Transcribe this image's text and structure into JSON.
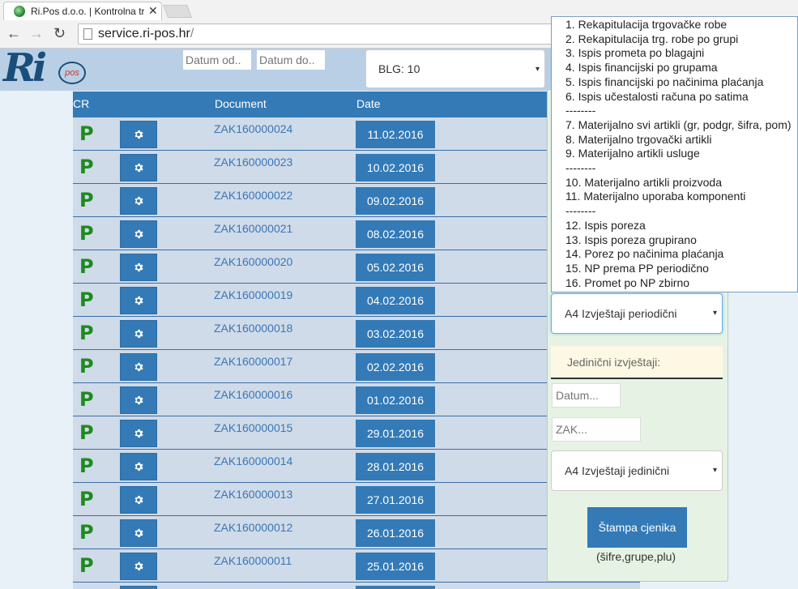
{
  "browser": {
    "tab_title": "Ri.Pos d.o.o. | Kontrolna tra",
    "tab_close": "✕",
    "nav_back": "←",
    "nav_forward": "→",
    "nav_reload": "↻",
    "url_host": "service.ri-pos.hr",
    "url_path": "/"
  },
  "header": {
    "logo_main": "Ri",
    "logo_badge": "pos",
    "date_from_placeholder": "Datum od..",
    "date_to_placeholder": "Datum do..",
    "blg_value": "BLG: 10",
    "caret": "▾"
  },
  "table": {
    "col_cr": "CR",
    "col_document": "Document",
    "col_date": "Date",
    "rows": [
      {
        "status": "P",
        "document": "ZAK160000024",
        "date": "11.02.2016"
      },
      {
        "status": "P",
        "document": "ZAK160000023",
        "date": "10.02.2016"
      },
      {
        "status": "P",
        "document": "ZAK160000022",
        "date": "09.02.2016"
      },
      {
        "status": "P",
        "document": "ZAK160000021",
        "date": "08.02.2016"
      },
      {
        "status": "P",
        "document": "ZAK160000020",
        "date": "05.02.2016"
      },
      {
        "status": "P",
        "document": "ZAK160000019",
        "date": "04.02.2016"
      },
      {
        "status": "P",
        "document": "ZAK160000018",
        "date": "03.02.2016"
      },
      {
        "status": "P",
        "document": "ZAK160000017",
        "date": "02.02.2016"
      },
      {
        "status": "P",
        "document": "ZAK160000016",
        "date": "01.02.2016"
      },
      {
        "status": "P",
        "document": "ZAK160000015",
        "date": "29.01.2016"
      },
      {
        "status": "P",
        "document": "ZAK160000014",
        "date": "28.01.2016"
      },
      {
        "status": "P",
        "document": "ZAK160000013",
        "date": "27.01.2016"
      },
      {
        "status": "P",
        "document": "ZAK160000012",
        "date": "26.01.2016"
      },
      {
        "status": "P",
        "document": "ZAK160000011",
        "date": "25.01.2016"
      },
      {
        "status": "",
        "document": "",
        "date": ""
      }
    ]
  },
  "reports": {
    "options": [
      "1. Rekapitulacija trgovačke robe",
      "2. Rekapitulacija trg. robe po grupi",
      "3. Ispis prometa po blagajni",
      "4. Ispis financijski po grupama",
      "5. Ispis financijski po načinima plaćanja",
      "6. Ispis učestalosti računa po satima",
      "--------",
      "7. Materijalno svi artikli (gr, podgr, šifra, pom)",
      "8. Materijalno trgovački artikli",
      "9. Materijalno artikli usluge",
      "--------",
      "10. Materijalno artikli proizvoda",
      "11. Materijalno uporaba komponenti",
      "--------",
      "12. Ispis poreza",
      "13. Ispis poreza grupirano",
      "14. Porez po načinima plaćanja",
      "15. NP prema PP periodično",
      "16. Promet po NP zbirno"
    ],
    "periodic_select": "A4 Izvještaji periodični",
    "single_label": "Jedinični izvještaji:",
    "datum_placeholder": "Datum...",
    "zak_placeholder": "ZAK...",
    "single_select": "A4 Izvještaji jedinični",
    "print_button": "Štampa cjenika",
    "print_sub": "(šifre,grupe,plu)"
  }
}
